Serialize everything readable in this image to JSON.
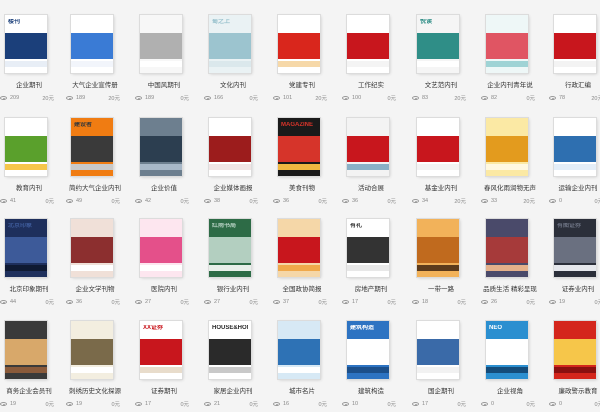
{
  "templates": [
    {
      "title": "企业期刊",
      "views": "209",
      "price": "20元",
      "cover_text": "楼刊",
      "colors": [
        "#ffffff",
        "#1b3f7a",
        "#e8eef6"
      ]
    },
    {
      "title": "大气企业宣传册",
      "views": "189",
      "price": "20元",
      "cover_text": "",
      "colors": [
        "#ffffff",
        "#3a7bd5",
        "#f2f5fb"
      ]
    },
    {
      "title": "中国风期刊",
      "views": "189",
      "price": "0元",
      "cover_text": "",
      "colors": [
        "#f7f7f7",
        "#b0b0b0",
        "#ffffff"
      ]
    },
    {
      "title": "文化内刊",
      "views": "166",
      "price": "0元",
      "cover_text": "蜀之上",
      "colors": [
        "#eaf2f4",
        "#9cc4cf",
        "#dbe8ec"
      ]
    },
    {
      "title": "党建专刊",
      "views": "101",
      "price": "20元",
      "cover_text": "",
      "colors": [
        "#ffffff",
        "#d9261c",
        "#f6d8a8"
      ]
    },
    {
      "title": "工作纪实",
      "views": "100",
      "price": "0元",
      "cover_text": "",
      "colors": [
        "#ffffff",
        "#c8161d",
        "#f4f4f4"
      ]
    },
    {
      "title": "文艺范内刊",
      "views": "83",
      "price": "20元",
      "cover_text": "悦读",
      "colors": [
        "#f5f5f5",
        "#2f8e87",
        "#ffffff"
      ]
    },
    {
      "title": "企业内刊青年说",
      "views": "82",
      "price": "0元",
      "cover_text": "",
      "colors": [
        "#eef7f7",
        "#e05563",
        "#9fd3d5"
      ]
    },
    {
      "title": "行政汇编",
      "views": "78",
      "price": "20元",
      "cover_text": "",
      "colors": [
        "#ffffff",
        "#c8161d",
        "#f3f3f3"
      ]
    },
    {
      "title": "教育内刊",
      "views": "41",
      "price": "0元",
      "cover_text": "",
      "colors": [
        "#ffffff",
        "#5aa02c",
        "#f6c64a"
      ]
    },
    {
      "title": "简约大气企业内刊",
      "views": "49",
      "price": "0元",
      "cover_text": "建设者",
      "colors": [
        "#f07c12",
        "#3a3a3a",
        "#c9c9c9"
      ]
    },
    {
      "title": "企业价值",
      "views": "42",
      "price": "0元",
      "cover_text": "",
      "colors": [
        "#6d7f8f",
        "#2c3e50",
        "#a8b8c8"
      ]
    },
    {
      "title": "企业媒体画报",
      "views": "38",
      "price": "0元",
      "cover_text": "",
      "colors": [
        "#ffffff",
        "#9c1c1c",
        "#f1e4e4"
      ]
    },
    {
      "title": "美食刊物",
      "views": "36",
      "price": "0元",
      "cover_text": "MAGAZINE",
      "colors": [
        "#1a1a1a",
        "#d6342a",
        "#f0b840"
      ]
    },
    {
      "title": "活动合展",
      "views": "36",
      "price": "0元",
      "cover_text": "",
      "colors": [
        "#f3f3f3",
        "#c8161d",
        "#8ab0c6"
      ]
    },
    {
      "title": "基金业内刊",
      "views": "34",
      "price": "20元",
      "cover_text": "",
      "colors": [
        "#ffffff",
        "#c8161d",
        "#f3f3f3"
      ]
    },
    {
      "title": "春风化雨润物无声",
      "views": "33",
      "price": "20元",
      "cover_text": "",
      "colors": [
        "#fbe9a4",
        "#e39b1e",
        "#fff8e0"
      ]
    },
    {
      "title": "运输企业内刊",
      "views": "0",
      "price": "0元",
      "cover_text": "",
      "colors": [
        "#ffffff",
        "#2e6fb0",
        "#e4eef8"
      ]
    },
    {
      "title": "北京印象期刊",
      "views": "44",
      "price": "0元",
      "cover_text": "北京印象",
      "colors": [
        "#1e2f5c",
        "#3d5a99",
        "#0f1a33"
      ]
    },
    {
      "title": "企业文学刊物",
      "views": "36",
      "price": "0元",
      "cover_text": "",
      "colors": [
        "#f0e0d8",
        "#8c2f2f",
        "#ffffff"
      ]
    },
    {
      "title": "医院内刊",
      "views": "27",
      "price": "0元",
      "cover_text": "",
      "colors": [
        "#fde6ef",
        "#e4508a",
        "#ffffff"
      ]
    },
    {
      "title": "银行业内刊",
      "views": "27",
      "price": "0元",
      "cover_text": "红雨书局",
      "colors": [
        "#2d6b46",
        "#b3cfc0",
        "#e8efe9"
      ]
    },
    {
      "title": "全国政协简报",
      "views": "37",
      "price": "0元",
      "cover_text": "",
      "colors": [
        "#f5d7a8",
        "#c8161d",
        "#f0a94b"
      ]
    },
    {
      "title": "房地产期刊",
      "views": "17",
      "price": "0元",
      "cover_text": "有礼",
      "colors": [
        "#ffffff",
        "#333333",
        "#e8e8e8"
      ]
    },
    {
      "title": "一带一路",
      "views": "18",
      "price": "0元",
      "cover_text": "",
      "colors": [
        "#f2b25a",
        "#c06a1e",
        "#5c3b1c"
      ]
    },
    {
      "title": "品质生活 精彩呈现",
      "views": "26",
      "price": "0元",
      "cover_text": "",
      "colors": [
        "#4a4a6a",
        "#a63a3a",
        "#e4b08a"
      ]
    },
    {
      "title": "证券业内刊",
      "views": "19",
      "price": "0元",
      "cover_text": "有图证券",
      "colors": [
        "#2b2f3a",
        "#6a7080",
        "#e5e7ec"
      ]
    },
    {
      "title": "商务企业会员刊",
      "views": "19",
      "price": "0元",
      "cover_text": "",
      "colors": [
        "#3a3a3a",
        "#d8a86a",
        "#8a5a3a"
      ]
    },
    {
      "title": "刺绣历史文化探源",
      "views": "19",
      "price": "0元",
      "cover_text": "",
      "colors": [
        "#f3eee0",
        "#7a6a4a",
        "#ffffff"
      ]
    },
    {
      "title": "证券期刊",
      "views": "17",
      "price": "0元",
      "cover_text": "XX证券",
      "colors": [
        "#ffffff",
        "#c8161d",
        "#e8dccb"
      ]
    },
    {
      "title": "家居企业内刊",
      "views": "21",
      "price": "0元",
      "cover_text": "HOUSE&HOME",
      "colors": [
        "#ffffff",
        "#2a2a2a",
        "#c9c9c9"
      ]
    },
    {
      "title": "城市名片",
      "views": "16",
      "price": "0元",
      "cover_text": "",
      "colors": [
        "#d7e9f5",
        "#2e72b5",
        "#ffffff"
      ]
    },
    {
      "title": "建筑构造",
      "views": "10",
      "price": "0元",
      "cover_text": "建筑构造",
      "colors": [
        "#2d73c2",
        "#ffffff",
        "#1c4f8a"
      ]
    },
    {
      "title": "国企期刊",
      "views": "17",
      "price": "0元",
      "cover_text": "",
      "colors": [
        "#ffffff",
        "#3a6aa8",
        "#f2f2f2"
      ]
    },
    {
      "title": "企业视角",
      "views": "0",
      "price": "0元",
      "cover_text": "NEO",
      "colors": [
        "#2b8fd0",
        "#ffffff",
        "#144c7a"
      ]
    },
    {
      "title": "廉政警示教育",
      "views": "0",
      "price": "0元",
      "cover_text": "",
      "colors": [
        "#d4261c",
        "#f6c64a",
        "#8a1010"
      ]
    }
  ]
}
